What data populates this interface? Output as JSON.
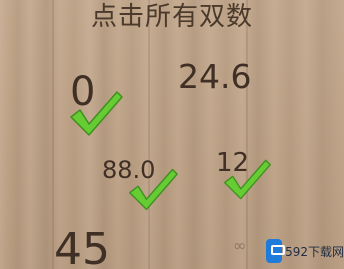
{
  "game": {
    "title": "点击所有双数",
    "numbers": [
      {
        "value": "0",
        "checked": true
      },
      {
        "value": "24.6",
        "checked": false
      },
      {
        "value": "88.0",
        "checked": true
      },
      {
        "value": "12",
        "checked": true
      },
      {
        "value": "45",
        "checked": false
      }
    ],
    "check_icon": "green-checkmark-icon",
    "check_color": "#66cc33",
    "infinity_symbol": "∞"
  },
  "watermark": {
    "text": "592下载网",
    "icon": "site-logo-icon",
    "brand_color": "#1e7bd9"
  }
}
